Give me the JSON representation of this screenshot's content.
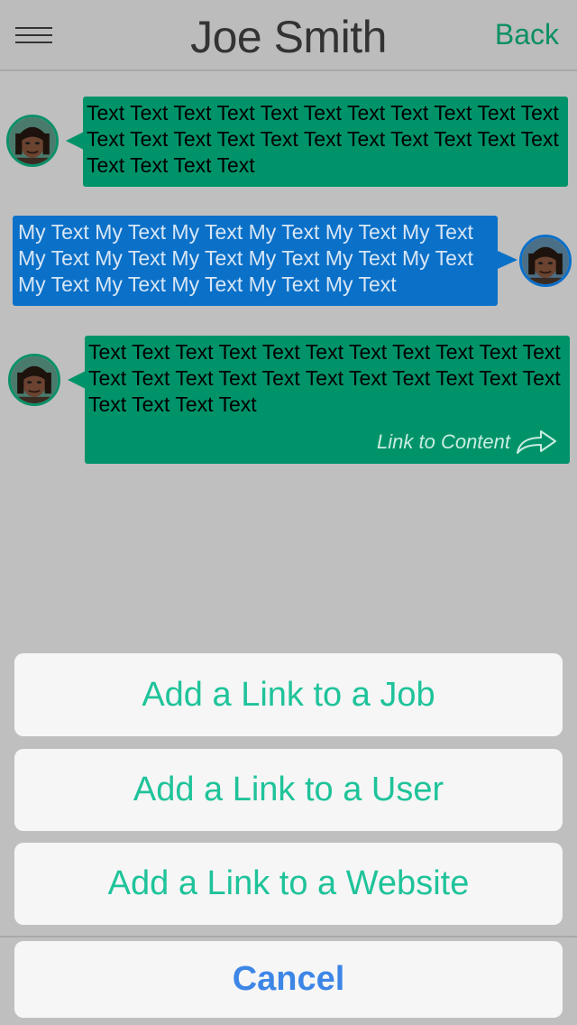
{
  "header": {
    "title": "Joe Smith",
    "back_label": "Back"
  },
  "messages": [
    {
      "sender": "other",
      "text": "Text Text Text Text Text Text Text Text Text Text Text Text Text Text Text Text Text Text Text Text Text Text Text Text Text Text"
    },
    {
      "sender": "me",
      "text": "My Text My Text My Text My Text My Text My Text My Text My Text My Text My Text My Text My Text My Text My Text My Text My Text My Text"
    },
    {
      "sender": "other",
      "text": "Text Text Text Text Text Text Text Text Text Text Text Text Text Text Text Text Text Text Text Text Text Text Text Text Text Text",
      "link_label": "Link to Content"
    }
  ],
  "action_sheet": {
    "options": [
      "Add a Link to a Job",
      "Add a Link to a User",
      "Add a Link to a Website"
    ],
    "cancel_label": "Cancel"
  },
  "colors": {
    "accent_green": "#00936a",
    "accent_blue": "#0a70c8",
    "option_text": "#1fc39a",
    "cancel_text": "#3d86e6"
  },
  "icons": [
    "menu-icon",
    "share-arrow-icon",
    "avatar"
  ]
}
